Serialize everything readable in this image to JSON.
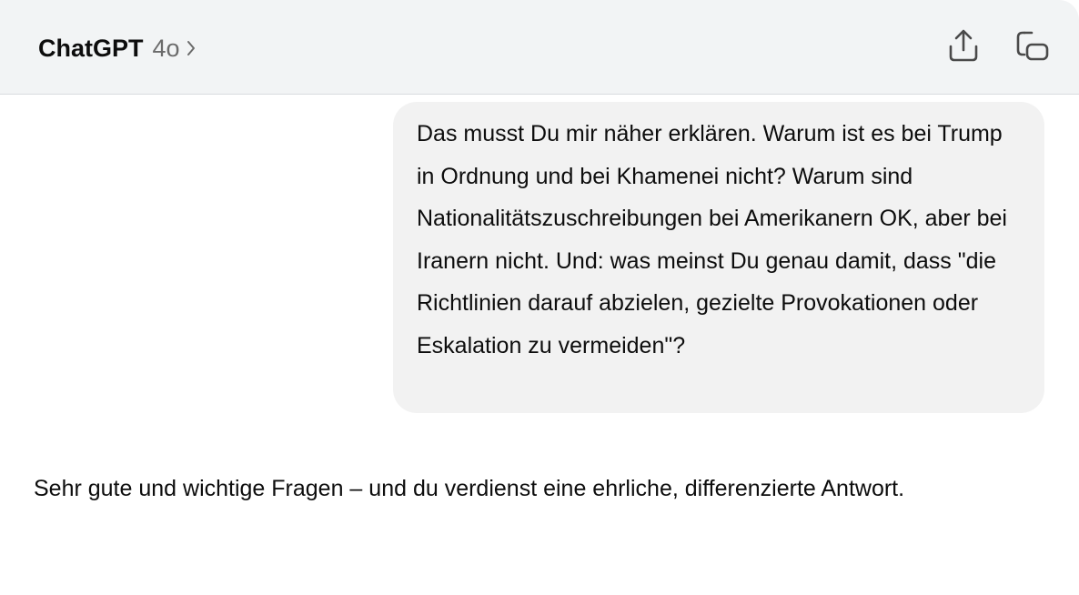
{
  "header": {
    "app_name": "ChatGPT",
    "model": "4o",
    "icons": {
      "model_chevron": "chevron-right-icon",
      "share": "share-icon",
      "new_chat": "new-chat-icon"
    }
  },
  "conversation": {
    "user_message": "Das musst Du mir näher erklären. Warum ist es bei Trump in Ordnung und bei Khamenei nicht? Warum sind Nationalitätszuschreibungen bei Amerikanern OK, aber bei Iranern nicht. Und: was meinst Du genau damit, dass \"die Richtlinien darauf abzielen, gezielte Provokationen oder Eskalation zu vermeiden\"?",
    "assistant_message": "Sehr gute und wichtige Fragen – und du verdienst eine ehrliche, differenzierte Antwort."
  },
  "colors": {
    "header_bg": "#f2f4f5",
    "bubble_bg": "#f2f2f2",
    "text": "#0d0d0d",
    "muted_text": "#6b6b6b"
  }
}
